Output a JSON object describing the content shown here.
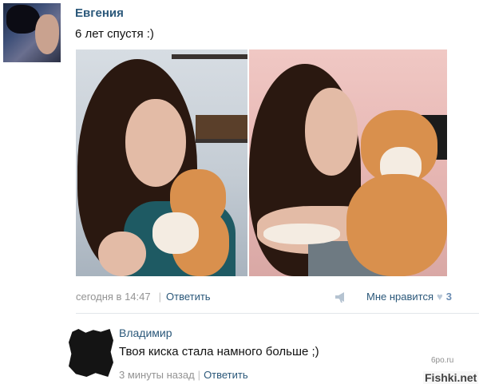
{
  "post": {
    "author": "Евгения",
    "text": "6 лет спустя :)",
    "timestamp": "сегодня в 14:47",
    "reply_label": "Ответить",
    "like_label": "Мне нравится",
    "like_count": "3"
  },
  "comment": {
    "author": "Владимир",
    "text": "Твоя киска стала намного больше ;)",
    "timestamp": "3 минуты назад",
    "reply_label": "Ответить"
  },
  "overlays": {
    "site_mark": "6po.ru",
    "watermark": "Fishki.net"
  },
  "icons": {
    "device": "apple-icon",
    "share": "megaphone-icon",
    "like": "heart-icon"
  },
  "colors": {
    "link": "#2b587a",
    "meta": "#939393"
  }
}
